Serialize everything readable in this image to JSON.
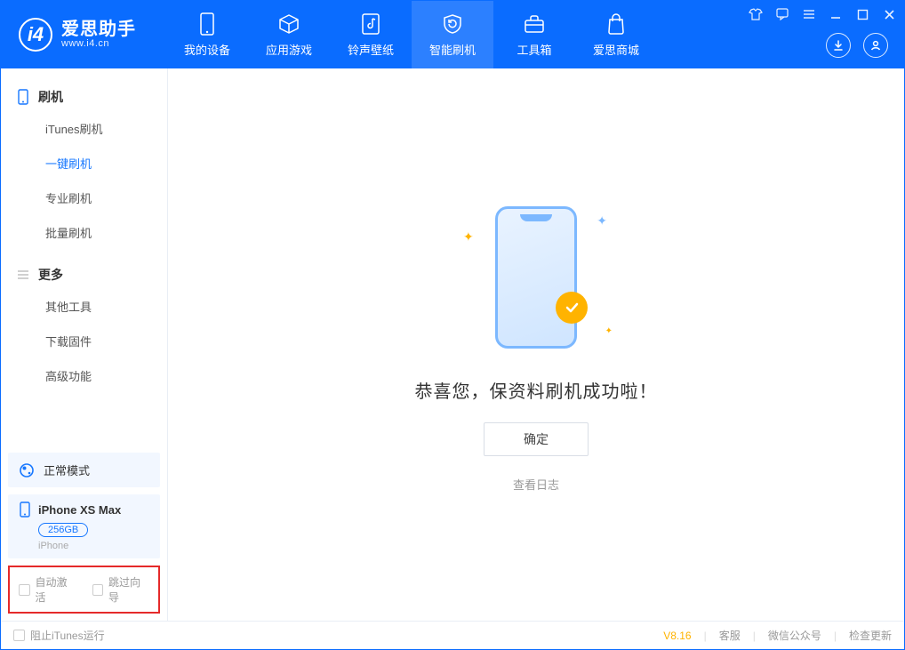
{
  "brand": {
    "cn": "爱思助手",
    "en": "www.i4.cn"
  },
  "tabs": [
    {
      "label": "我的设备"
    },
    {
      "label": "应用游戏"
    },
    {
      "label": "铃声壁纸"
    },
    {
      "label": "智能刷机"
    },
    {
      "label": "工具箱"
    },
    {
      "label": "爱思商城"
    }
  ],
  "sidebar": {
    "section1_title": "刷机",
    "items1": [
      {
        "label": "iTunes刷机"
      },
      {
        "label": "一键刷机"
      },
      {
        "label": "专业刷机"
      },
      {
        "label": "批量刷机"
      }
    ],
    "section2_title": "更多",
    "items2": [
      {
        "label": "其他工具"
      },
      {
        "label": "下载固件"
      },
      {
        "label": "高级功能"
      }
    ]
  },
  "mode": {
    "text": "正常模式"
  },
  "device": {
    "name": "iPhone XS Max",
    "storage": "256GB",
    "type": "iPhone"
  },
  "bottom_checks": {
    "auto_activate": "自动激活",
    "skip_guide": "跳过向导"
  },
  "main": {
    "success": "恭喜您，保资料刷机成功啦！",
    "ok": "确定",
    "view_log": "查看日志"
  },
  "statusbar": {
    "block_itunes": "阻止iTunes运行",
    "version": "V8.16",
    "cs": "客服",
    "wechat": "微信公众号",
    "check_update": "检查更新"
  },
  "colors": {
    "primary": "#0a6cff",
    "accent": "#ffb300"
  }
}
